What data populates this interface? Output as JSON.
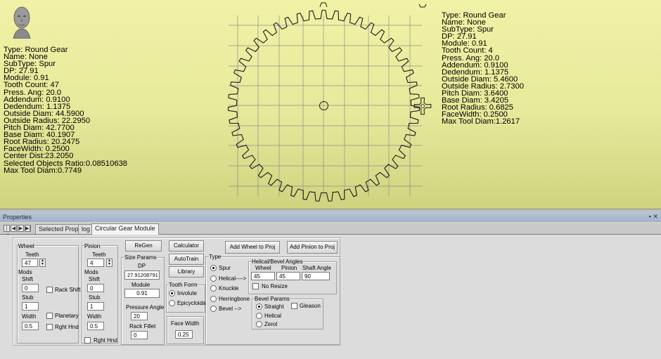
{
  "viewport": {
    "background_color": "#e9eba0",
    "wheel_info": [
      "Type: Round Gear",
      "Name: None",
      "SubType: Spur",
      "DP: 27.91",
      "Module: 0.91",
      "Tooth Count: 47",
      "Press. Ang: 20.0",
      "Addendum: 0.9100",
      "Dedendum: 1.1375",
      "Outside Diam: 44.5900",
      "Outside Radius: 22.2950",
      "Pitch Diam: 42.7700",
      "Base Diam: 40.1907",
      "Root Radius: 20.2475",
      "FaceWidth: 0.2500",
      "Center Dist:23.2050",
      "Selected Objects Ratio:0.08510638",
      "Max Tool Diam:0.7749"
    ],
    "pinion_info": [
      "Type: Round Gear",
      "Name: None",
      "SubType: Spur",
      "DP: 27.91",
      "Module: 0.91",
      "Tooth Count: 4",
      "Press. Ang: 20.0",
      "Addendum: 0.9100",
      "Dedendum: 1.1375",
      "Outside Diam: 5.4600",
      "Outside Radius: 2.7300",
      "Pitch Diam: 3.6400",
      "Base Diam: 3.4205",
      "Root Radius: 0.6825",
      "FaceWidth: 0.2500",
      "Max Tool Diam:1.2617"
    ],
    "avatar_icon": "user-head-icon"
  },
  "properties_bar": {
    "title": "Properties",
    "pin_icon": "pin-icon",
    "close_icon": "close-icon",
    "pin_glyph": "▪",
    "close_glyph": "✕"
  },
  "tabs": {
    "nav_first": "|◀",
    "nav_prev": "◀",
    "nav_next": "▶",
    "nav_last": "▶|",
    "items": [
      "Selected Props",
      "log",
      "Circular Gear Module"
    ]
  },
  "wheel": {
    "group_label": "Wheel",
    "teeth_label": "Teeth",
    "teeth_value": "47",
    "mods_label": "Mods",
    "shift_label": "Shift",
    "shift_value": "0",
    "stub_label": "Stub",
    "stub_value": "1",
    "width_label": "Width",
    "width_value": "0.5",
    "rack_shift_label": "Rack Shift",
    "planetary_label": "Planetary",
    "rght_hnd_label": "Rght Hnd"
  },
  "pinion": {
    "group_label": "Pinion",
    "teeth_label": "Teeth",
    "teeth_value": "4",
    "mods_label": "Mods",
    "shift_label": "Shift",
    "shift_value": "0",
    "stub_label": "Stub",
    "stub_value": "1",
    "width_label": "Width",
    "width_value": "0.5",
    "rght_hnd_label": "Rght Hnd"
  },
  "spin_up": "▲",
  "spin_down": "▼",
  "buttons": {
    "regen": "ReGen",
    "calculator": "Calculator",
    "autotrain": "AutoTrain",
    "library": "Library",
    "add_wheel": "Add Wheel to Proj",
    "add_pinion": "Add Pinion to Proj"
  },
  "size_params": {
    "group_label": "Size Params",
    "dp_label": "DP",
    "dp_value": "27.91208791",
    "module_label": "Module",
    "module_value": "0.91",
    "pressure_angle_label": "Pressure Angle",
    "pressure_angle_value": "20",
    "rack_fillet_label": "Rack Fillet",
    "rack_fillet_value": "0"
  },
  "tooth_form": {
    "group_label": "Tooth Form",
    "involute": "Involute",
    "epicycloidal": "Epicycloidal",
    "selected": "Involute"
  },
  "face_width": {
    "group_label": "Face Width",
    "value": "0.25"
  },
  "type": {
    "group_label": "Type",
    "spur": "Spur",
    "helical": "Helical---->",
    "knuckle": "Knuckle",
    "herringbone": "Herringbone",
    "bevel": "Bevel    -->",
    "selected": "Spur"
  },
  "helical_bevel": {
    "group_label": "Helical/Bevel Angles",
    "wheel_label": "Wheel",
    "pinion_label": "Pinion",
    "shaft_angle_label": "Shaft Angle",
    "wheel_value": "45",
    "pinion_value": "45",
    "shaft_angle_value": "90",
    "no_resize_label": "No Resize"
  },
  "bevel_params": {
    "group_label": "Bevel Params",
    "straight": "Straight",
    "helical": "Helical",
    "zerol": "Zerol",
    "gleason": "Gleason",
    "selected": "Straight"
  }
}
